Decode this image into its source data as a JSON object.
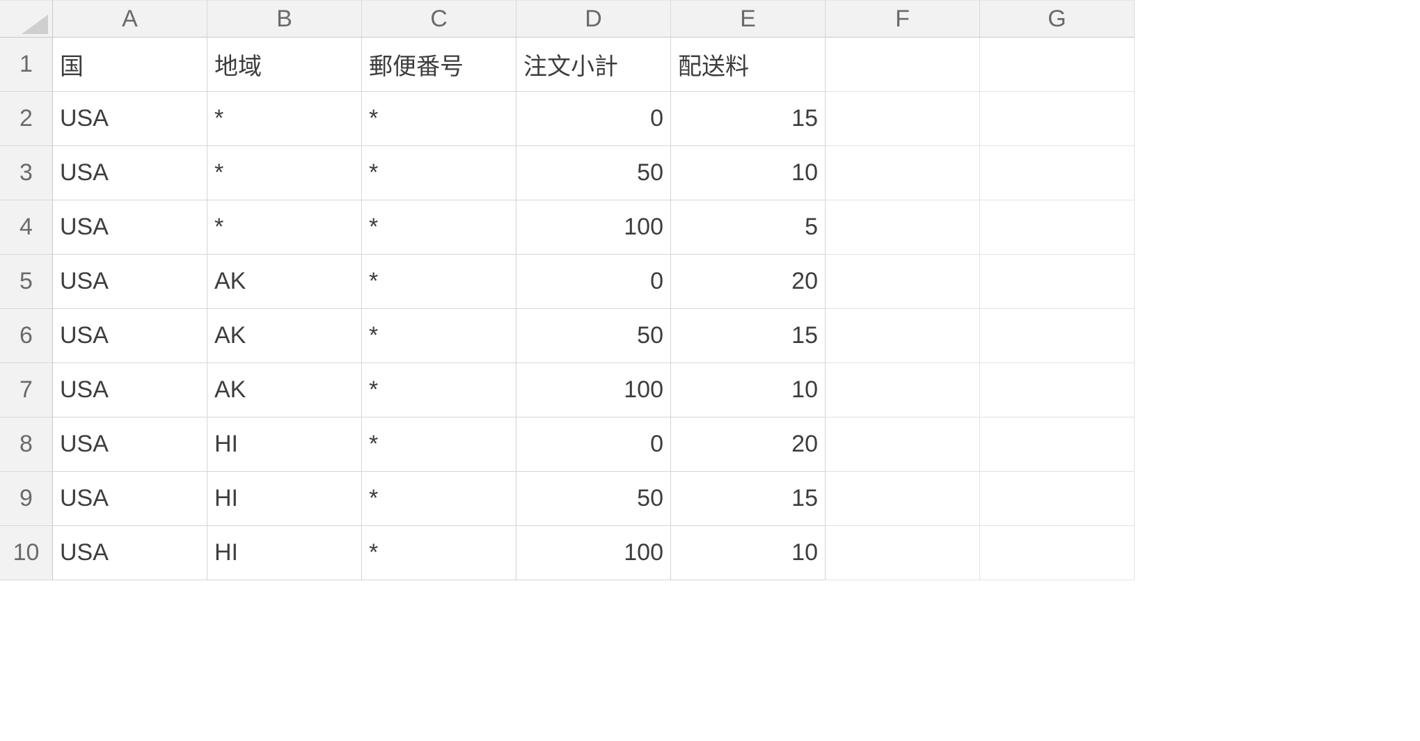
{
  "spreadsheet": {
    "columns": [
      "A",
      "B",
      "C",
      "D",
      "E",
      "F",
      "G"
    ],
    "row_numbers": [
      "1",
      "2",
      "3",
      "4",
      "5",
      "6",
      "7",
      "8",
      "9",
      "10"
    ],
    "headers": {
      "A": "国",
      "B": "地域",
      "C": "郵便番号",
      "D": "注文小計",
      "E": "配送料"
    },
    "rows": [
      {
        "A": "USA",
        "B": "*",
        "C": "*",
        "D": "0",
        "E": "15"
      },
      {
        "A": "USA",
        "B": "*",
        "C": "*",
        "D": "50",
        "E": "10"
      },
      {
        "A": "USA",
        "B": "*",
        "C": "*",
        "D": "100",
        "E": "5"
      },
      {
        "A": "USA",
        "B": "AK",
        "C": "*",
        "D": "0",
        "E": "20"
      },
      {
        "A": "USA",
        "B": "AK",
        "C": "*",
        "D": "50",
        "E": "15"
      },
      {
        "A": "USA",
        "B": "AK",
        "C": "*",
        "D": "100",
        "E": "10"
      },
      {
        "A": "USA",
        "B": "HI",
        "C": "*",
        "D": "0",
        "E": "20"
      },
      {
        "A": "USA",
        "B": "HI",
        "C": "*",
        "D": "50",
        "E": "15"
      },
      {
        "A": "USA",
        "B": "HI",
        "C": "*",
        "D": "100",
        "E": "10"
      }
    ],
    "numeric_columns": [
      "D",
      "E"
    ]
  }
}
